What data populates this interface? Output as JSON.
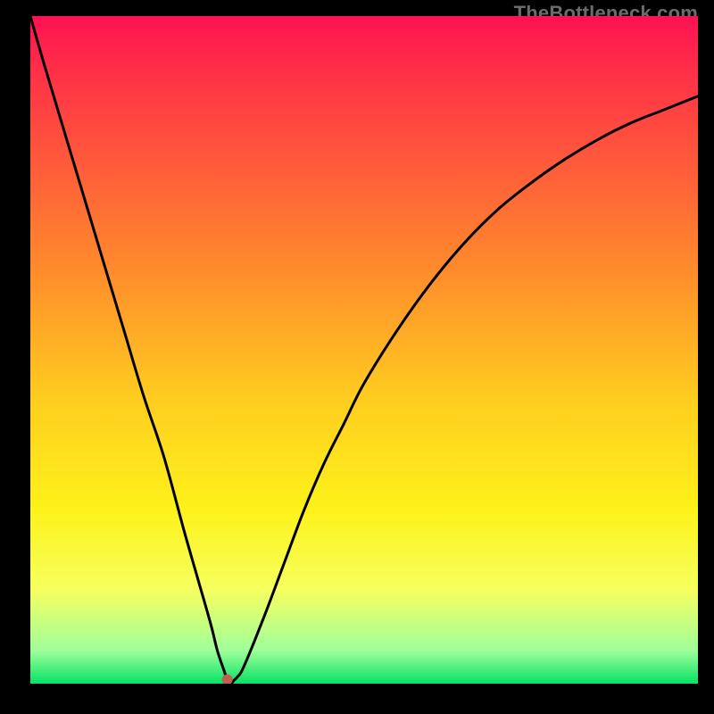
{
  "attribution": "TheBottleneck.com",
  "colors": {
    "frame": "#000000",
    "curve": "#000000",
    "marker": "#c06050",
    "gradient_stops": [
      "#ff1152",
      "#ff2f48",
      "#ff5d3a",
      "#ff8b2c",
      "#ffcf1f",
      "#fdf21a",
      "#f6ff5f",
      "#a0ff9b",
      "#07e264"
    ]
  },
  "chart_data": {
    "type": "line",
    "title": "",
    "xlabel": "",
    "ylabel": "",
    "xlim": [
      0,
      100
    ],
    "ylim": [
      0,
      100
    ],
    "x": [
      0,
      2,
      5,
      8,
      11,
      14,
      17,
      20,
      23,
      25,
      27,
      28,
      29,
      29.5,
      30,
      30.5,
      31,
      32,
      35,
      38,
      41,
      44,
      47,
      50,
      55,
      60,
      65,
      70,
      75,
      80,
      85,
      90,
      95,
      100
    ],
    "values": [
      100,
      93,
      83,
      73,
      63,
      53,
      43,
      34,
      23,
      16,
      9,
      5,
      2,
      0.6,
      0,
      0.5,
      1,
      2.6,
      10,
      18,
      26,
      33,
      39,
      45,
      53,
      60,
      66,
      71,
      75,
      78.5,
      81.5,
      84,
      86,
      88
    ],
    "marker": {
      "x": 29.5,
      "y": 0.6
    }
  }
}
